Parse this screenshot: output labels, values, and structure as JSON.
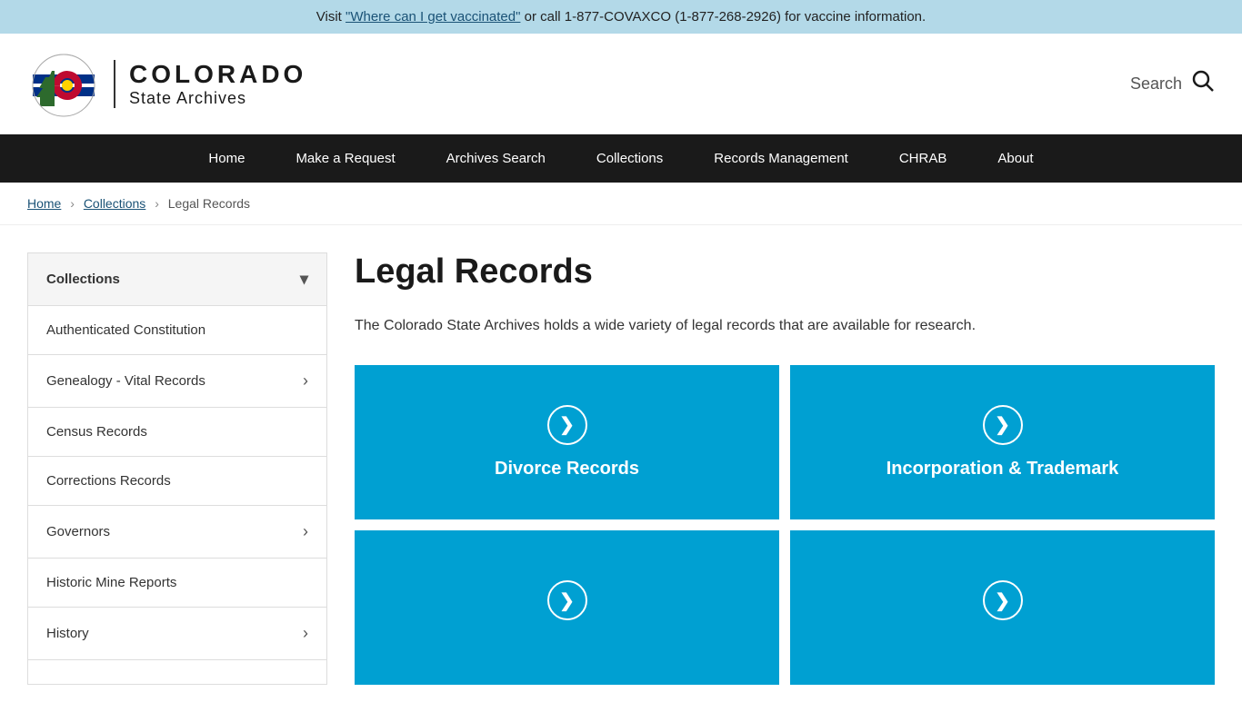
{
  "banner": {
    "text_before": "Visit ",
    "link_text": "\"Where can I get vaccinated\"",
    "text_after": " or call 1-877-COVAXCO (1-877-268-2926) for vaccine information."
  },
  "header": {
    "state_name": "COLORADO",
    "archives": "State Archives",
    "search_label": "Search"
  },
  "nav": {
    "items": [
      {
        "label": "Home",
        "href": "#"
      },
      {
        "label": "Make a Request",
        "href": "#"
      },
      {
        "label": "Archives Search",
        "href": "#"
      },
      {
        "label": "Collections",
        "href": "#"
      },
      {
        "label": "Records Management",
        "href": "#"
      },
      {
        "label": "CHRAB",
        "href": "#"
      },
      {
        "label": "About",
        "href": "#"
      }
    ]
  },
  "breadcrumb": {
    "home": "Home",
    "collections": "Collections",
    "current": "Legal Records"
  },
  "page": {
    "title": "Legal Records",
    "description": "The Colorado State Archives holds a wide variety of legal records that are available for research."
  },
  "sidebar": {
    "header": "Collections",
    "items": [
      {
        "label": "Authenticated Constitution",
        "hasChevron": false
      },
      {
        "label": "Genealogy - Vital Records",
        "hasChevron": true
      },
      {
        "label": "Census Records",
        "hasChevron": false
      },
      {
        "label": "Corrections Records",
        "hasChevron": false
      },
      {
        "label": "Governors",
        "hasChevron": true
      },
      {
        "label": "Historic Mine Reports",
        "hasChevron": false
      },
      {
        "label": "History",
        "hasChevron": true
      }
    ]
  },
  "cards": [
    {
      "label": "Divorce Records",
      "arrow": "❯"
    },
    {
      "label": "Incorporation & Trademark",
      "arrow": "❯"
    },
    {
      "label": "",
      "arrow": "❯"
    },
    {
      "label": "",
      "arrow": "❯"
    }
  ]
}
